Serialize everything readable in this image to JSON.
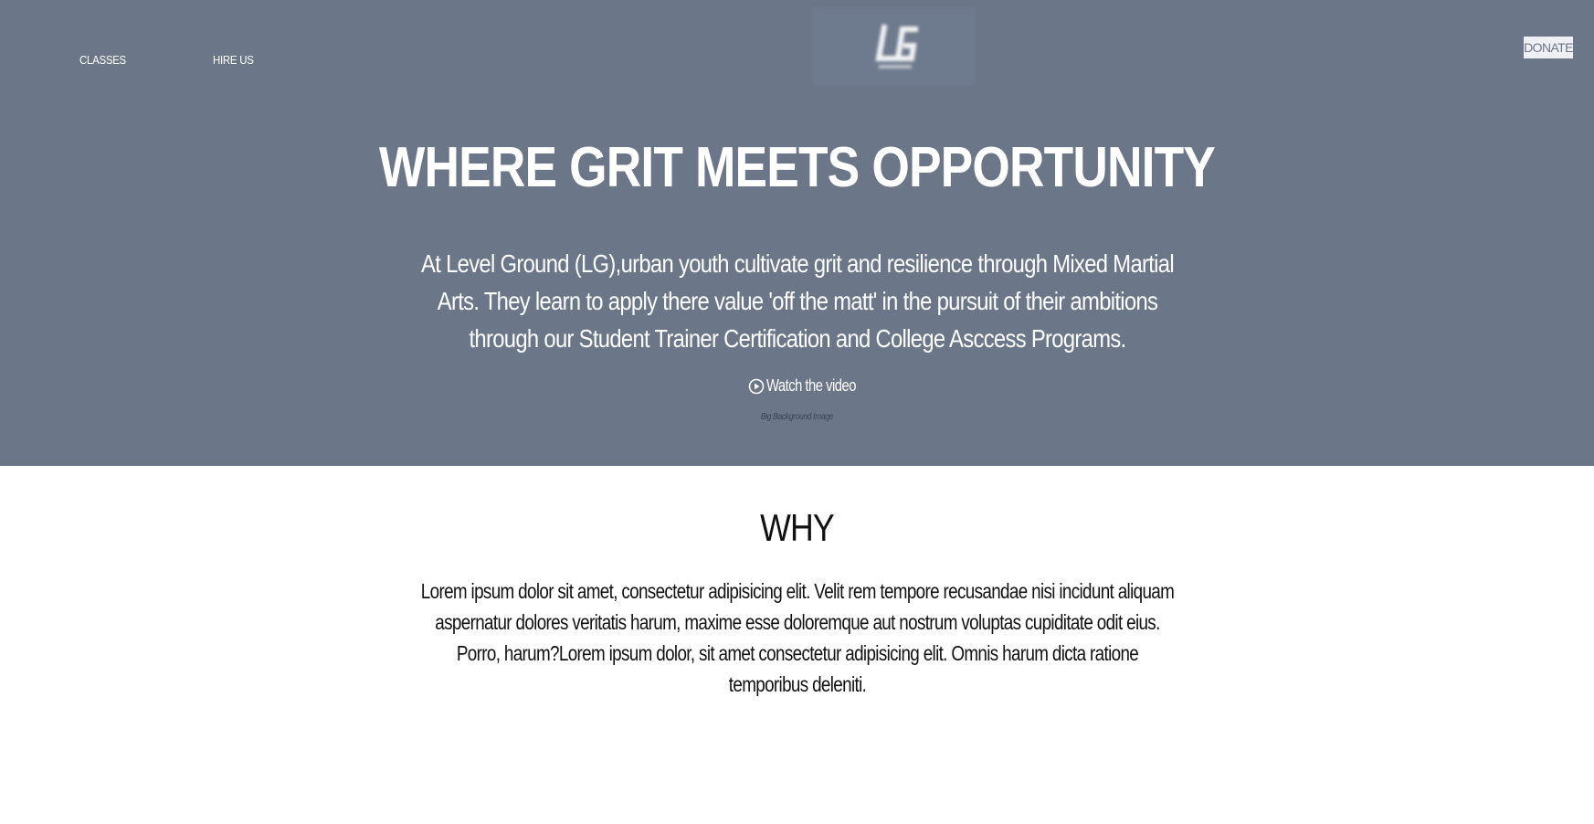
{
  "nav": {
    "classes_label": "CLASSES",
    "hire_label": "HIRE US",
    "donate_label": "DONATE",
    "logo_icon": "lg-logo-icon"
  },
  "hero": {
    "title": "WHERE GRIT MEETS OPPORTUNITY",
    "text": "At Level Ground (LG),urban youth cultivate grit and resilience through Mixed Martial Arts. They learn to apply there value 'off the matt' in the pursuit of their ambitions through our Student Trainer Certification and College Asccess Programs.",
    "watch_label": "Watch the video",
    "watch_icon": "play-circle-icon",
    "caption": "Big Background Image",
    "background_color": "#6b7789"
  },
  "why": {
    "title": "WHY",
    "text": "Lorem ipsum dolor sit amet, consectetur adipisicing elit. Velit rem tempore recusandae nisi incidunt aliquam aspernatur dolores veritatis harum, maxime esse doloremque aut nostrum voluptas cupiditate odit eius. Porro, harum?Lorem ipsum dolor, sit amet consectetur adipisicing elit. Omnis harum dicta ratione temporibus deleniti."
  }
}
